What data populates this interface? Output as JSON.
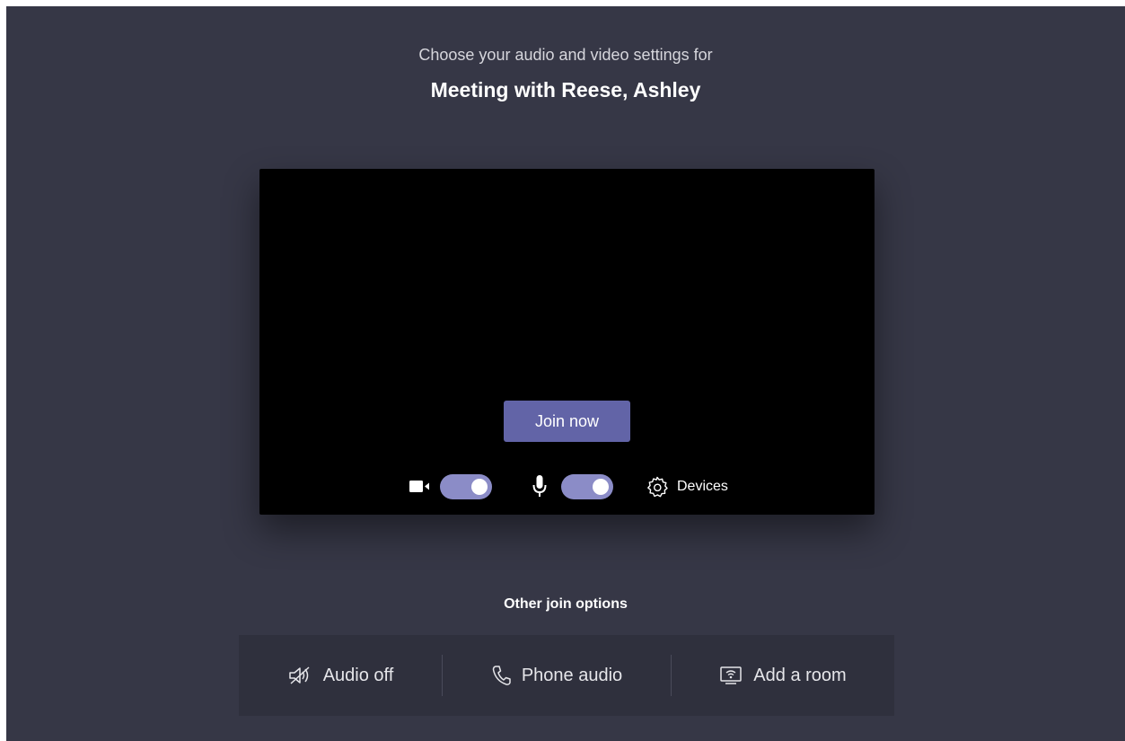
{
  "header": {
    "subtitle": "Choose your audio and video settings for",
    "meeting_title": "Meeting with Reese, Ashley"
  },
  "preview": {
    "join_label": "Join now",
    "camera_toggle_on": true,
    "mic_toggle_on": true,
    "devices_label": "Devices"
  },
  "other_options": {
    "heading": "Other join options",
    "items": [
      {
        "label": "Audio off",
        "icon": "speaker-off-icon"
      },
      {
        "label": "Phone audio",
        "icon": "phone-icon"
      },
      {
        "label": "Add a room",
        "icon": "room-cast-icon"
      }
    ]
  },
  "colors": {
    "background": "#363746",
    "accent": "#6264a7",
    "toggle_on": "#8b8cc7",
    "options_bar": "#2f303d"
  }
}
